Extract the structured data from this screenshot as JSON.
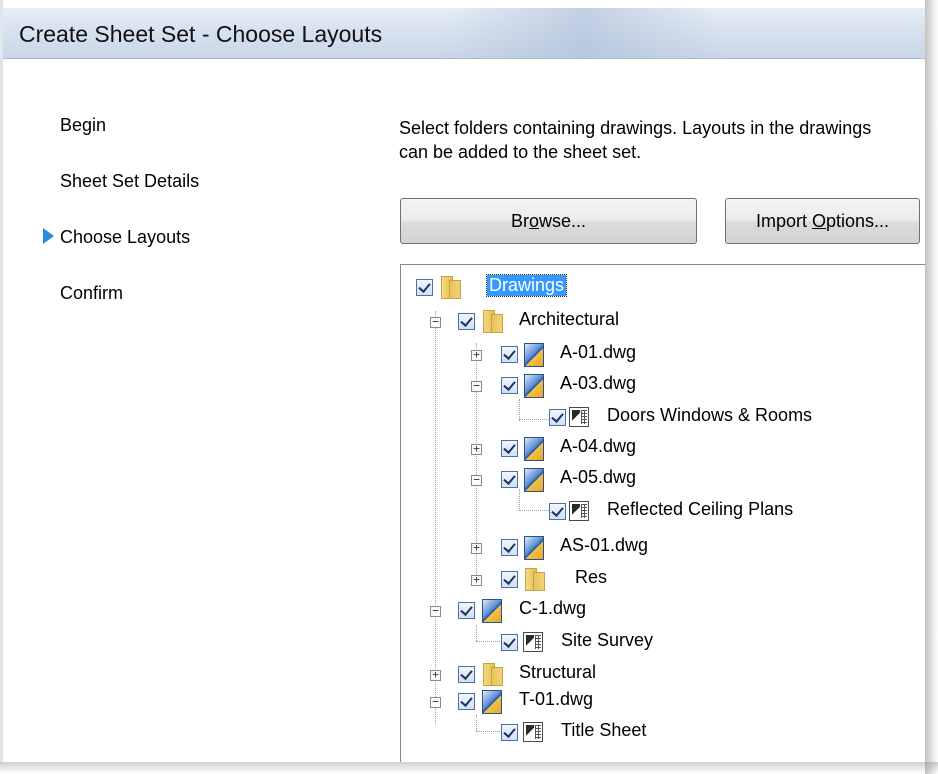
{
  "window": {
    "title": "Create Sheet Set - Choose Layouts"
  },
  "steps": [
    {
      "label": "Begin",
      "current": false
    },
    {
      "label": "Sheet Set Details",
      "current": false
    },
    {
      "label": "Choose Layouts",
      "current": true
    },
    {
      "label": "Confirm",
      "current": false
    }
  ],
  "instructions": "Select folders containing drawings.  Layouts in the drawings can be added to the sheet set.",
  "buttons": {
    "browse": {
      "before": "Br",
      "mnemonic": "o",
      "after": "wse..."
    },
    "import_options": {
      "before": "Import ",
      "mnemonic": "O",
      "after": "ptions..."
    }
  },
  "tree": {
    "nodes": [
      {
        "label": "Drawings",
        "type": "folder",
        "level": 0,
        "expander": "none",
        "checked": true,
        "selected": true
      },
      {
        "label": "Architectural",
        "type": "folder",
        "level": 1,
        "expander": "minus",
        "checked": true
      },
      {
        "label": "A-01.dwg",
        "type": "dwg",
        "level": 2,
        "expander": "plus",
        "checked": true
      },
      {
        "label": "A-03.dwg",
        "type": "dwg",
        "level": 2,
        "expander": "minus",
        "checked": true
      },
      {
        "label": "Doors Windows & Rooms",
        "type": "layout",
        "level": 3,
        "expander": "none",
        "checked": true
      },
      {
        "label": "A-04.dwg",
        "type": "dwg",
        "level": 2,
        "expander": "plus",
        "checked": true
      },
      {
        "label": "A-05.dwg",
        "type": "dwg",
        "level": 2,
        "expander": "minus",
        "checked": true
      },
      {
        "label": "Reflected Ceiling Plans",
        "type": "layout",
        "level": 3,
        "expander": "none",
        "checked": true
      },
      {
        "label": "AS-01.dwg",
        "type": "dwg",
        "level": 2,
        "expander": "plus",
        "checked": true
      },
      {
        "label": "Res",
        "type": "folder",
        "level": 2,
        "expander": "plus",
        "checked": true
      },
      {
        "label": "C-1.dwg",
        "type": "dwg",
        "level": 1,
        "expander": "minus",
        "checked": true
      },
      {
        "label": "Site Survey",
        "type": "layout",
        "level": 2,
        "expander": "none",
        "checked": true
      },
      {
        "label": "Structural",
        "type": "folder",
        "level": 1,
        "expander": "plus",
        "checked": true
      },
      {
        "label": "T-01.dwg",
        "type": "dwg",
        "level": 1,
        "expander": "minus",
        "checked": true
      },
      {
        "label": "Title Sheet",
        "type": "layout",
        "level": 2,
        "expander": "none",
        "checked": true
      }
    ]
  },
  "colors": {
    "step_marker": "#2b8ae0",
    "selection": "#3399ff"
  }
}
